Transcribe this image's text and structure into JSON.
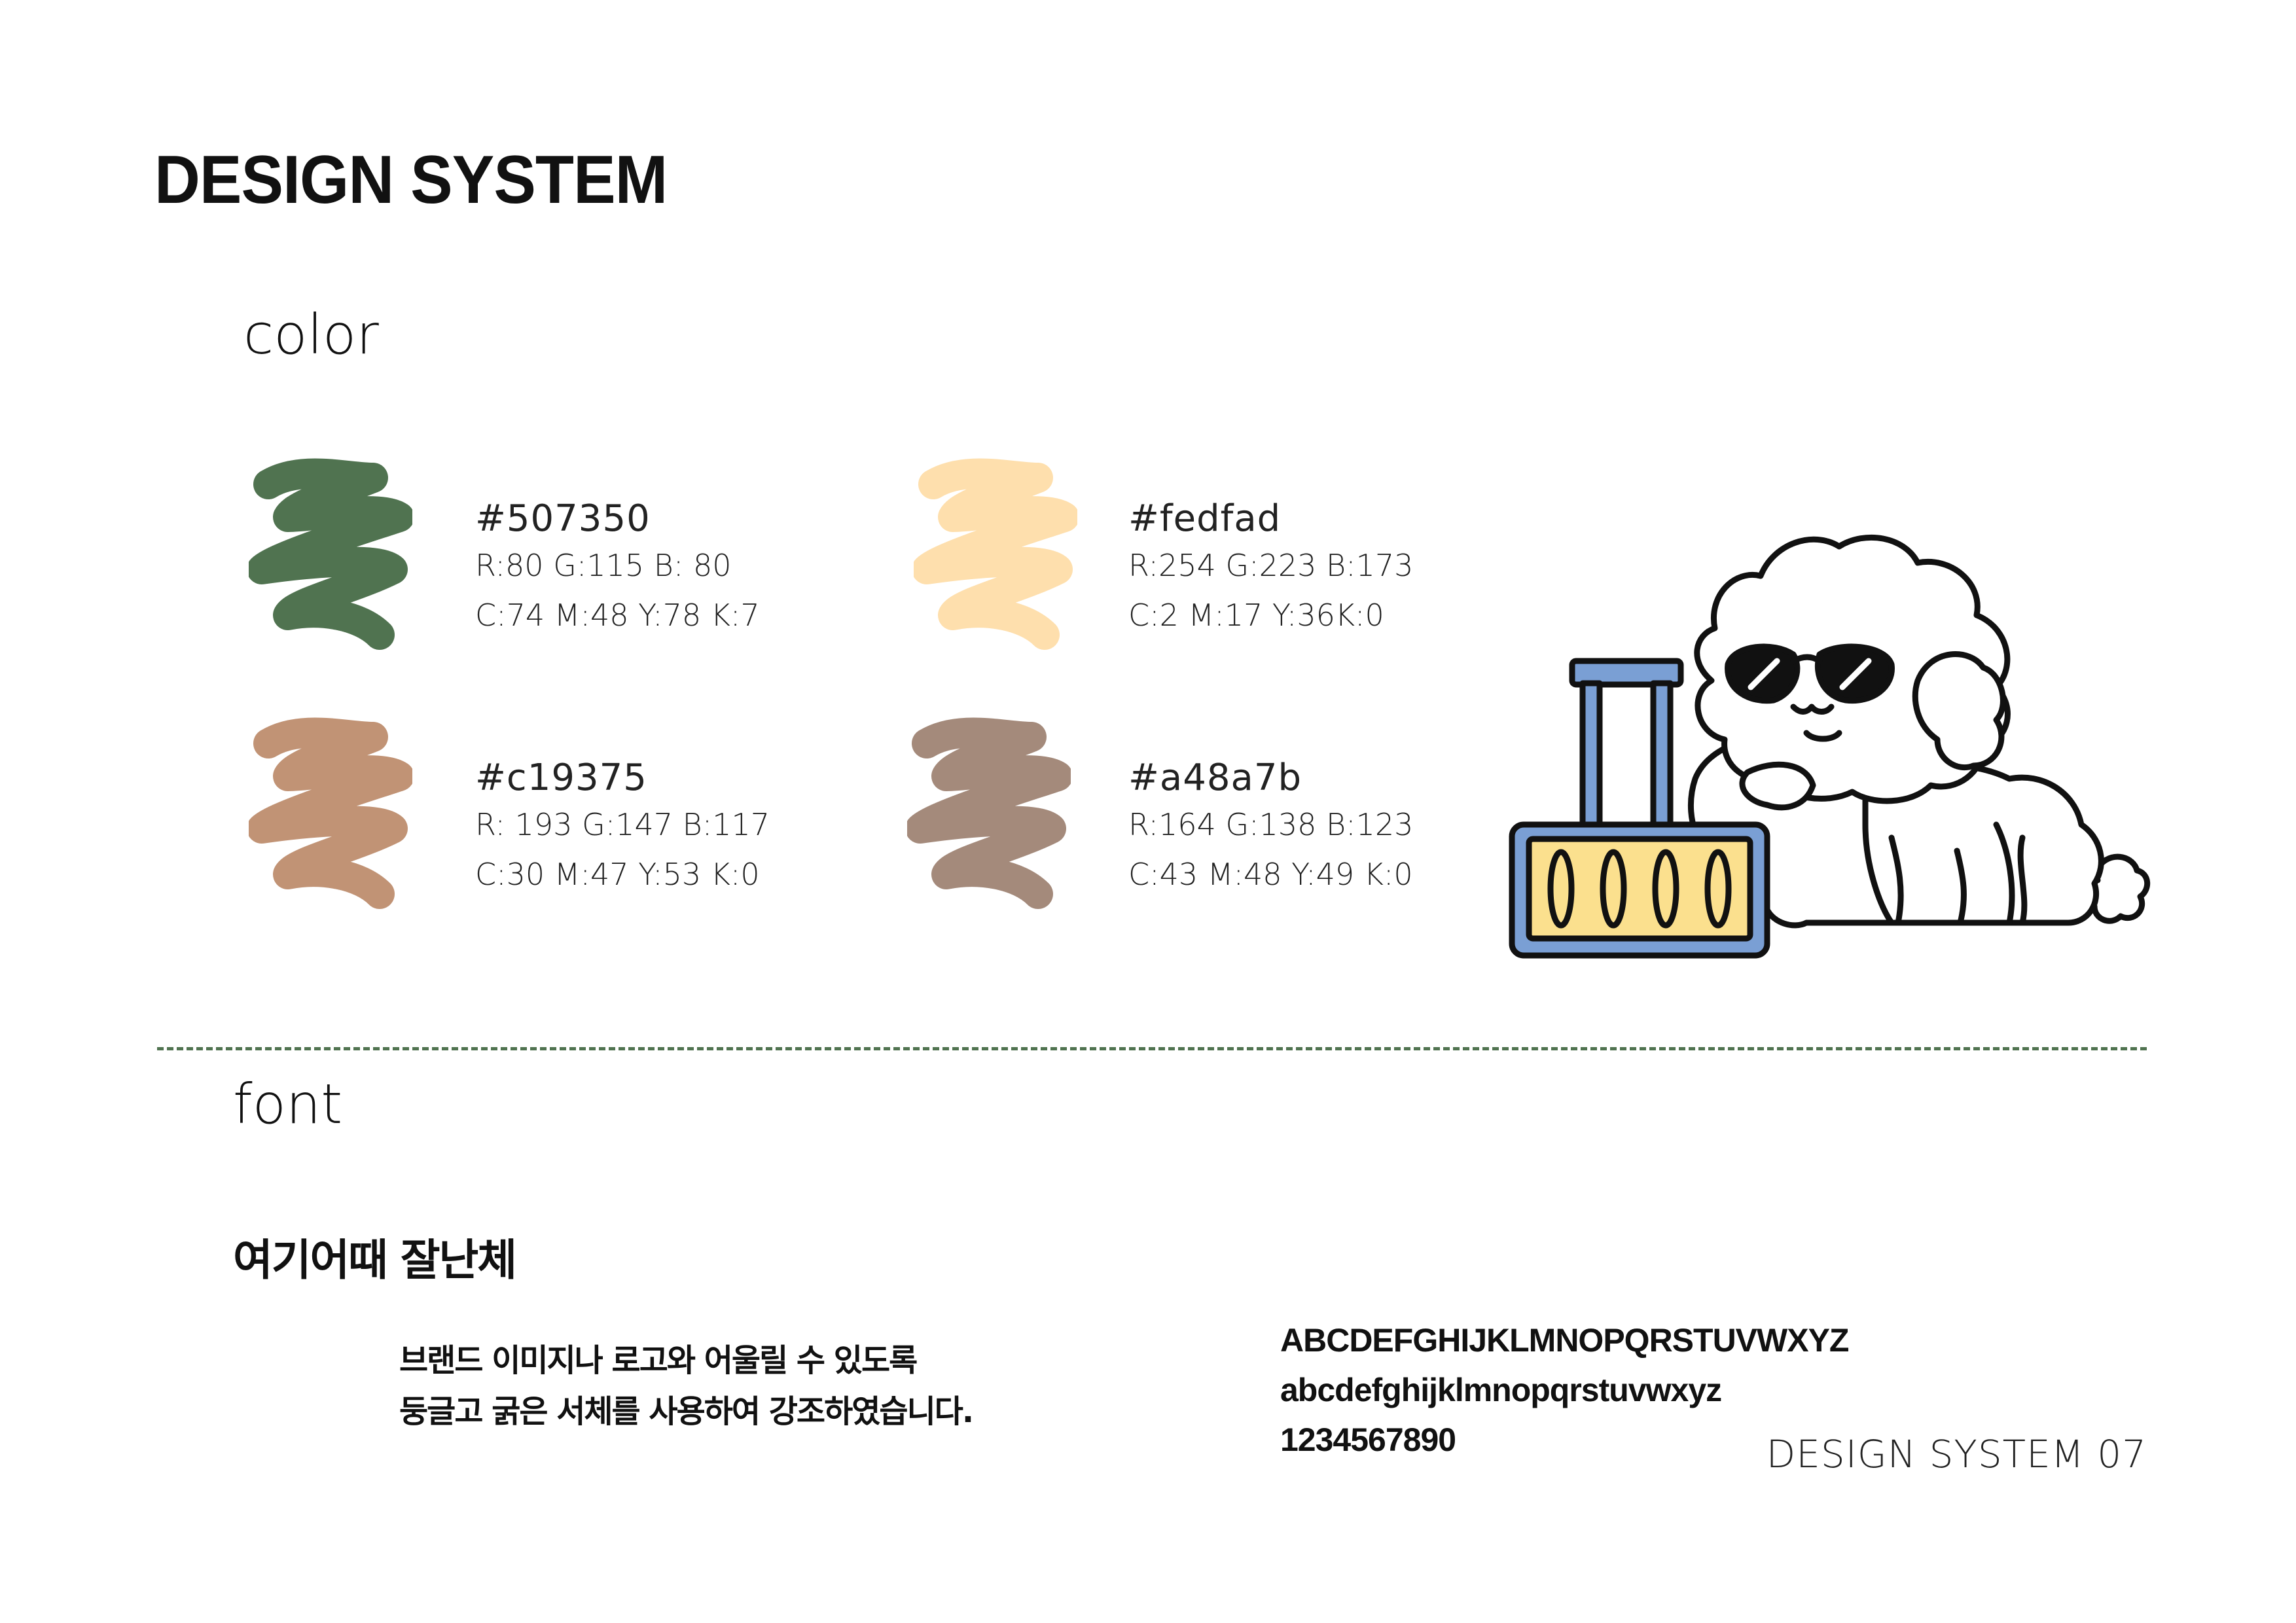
{
  "header": {
    "title": "DESIGN SYSTEM"
  },
  "color_section": {
    "label": "color",
    "swatches": [
      {
        "hex": "#507350",
        "rgb": "R:80 G:115 B: 80",
        "cmyk": "C:74 M:48 Y:78 K:7",
        "fill": "#507350"
      },
      {
        "hex": "#fedfad",
        "rgb": "R:254 G:223 B:173",
        "cmyk": "C:2 M:17 Y:36K:0",
        "fill": "#fedfad"
      },
      {
        "hex": "#c19375",
        "rgb": "R: 193 G:147 B:117",
        "cmyk": "C:30 M:47 Y:53 K:0",
        "fill": "#c19375"
      },
      {
        "hex": "#a48a7b",
        "rgb": "R:164 G:138 B:123",
        "cmyk": "C:43 M:48 Y:49 K:0",
        "fill": "#a48a7b"
      }
    ]
  },
  "illustration": {
    "name": "dog-with-sunglasses-and-suitcase",
    "lock_digits": [
      "0",
      "0",
      "0",
      "0"
    ],
    "colors": {
      "outline": "#111111",
      "suitcase_frame": "#7a9fd4",
      "suitcase_panel": "#fbe08e",
      "body": "#ffffff"
    }
  },
  "divider_color": "#507350",
  "font_section": {
    "label": "font",
    "font_name": "여기어때 잘난체",
    "description": [
      "브랜드 이미지나 로고와 어울릴 수 있도록",
      "둥글고 굵은 서체를 사용하여 강조하였습니다."
    ],
    "samples": [
      "ABCDEFGHIJKLMNOPQRSTUVWXYZ",
      "abcdefghijklmnopqrstuvwxyz",
      "1234567890"
    ]
  },
  "footer": {
    "label": "DESIGN SYSTEM 07"
  }
}
